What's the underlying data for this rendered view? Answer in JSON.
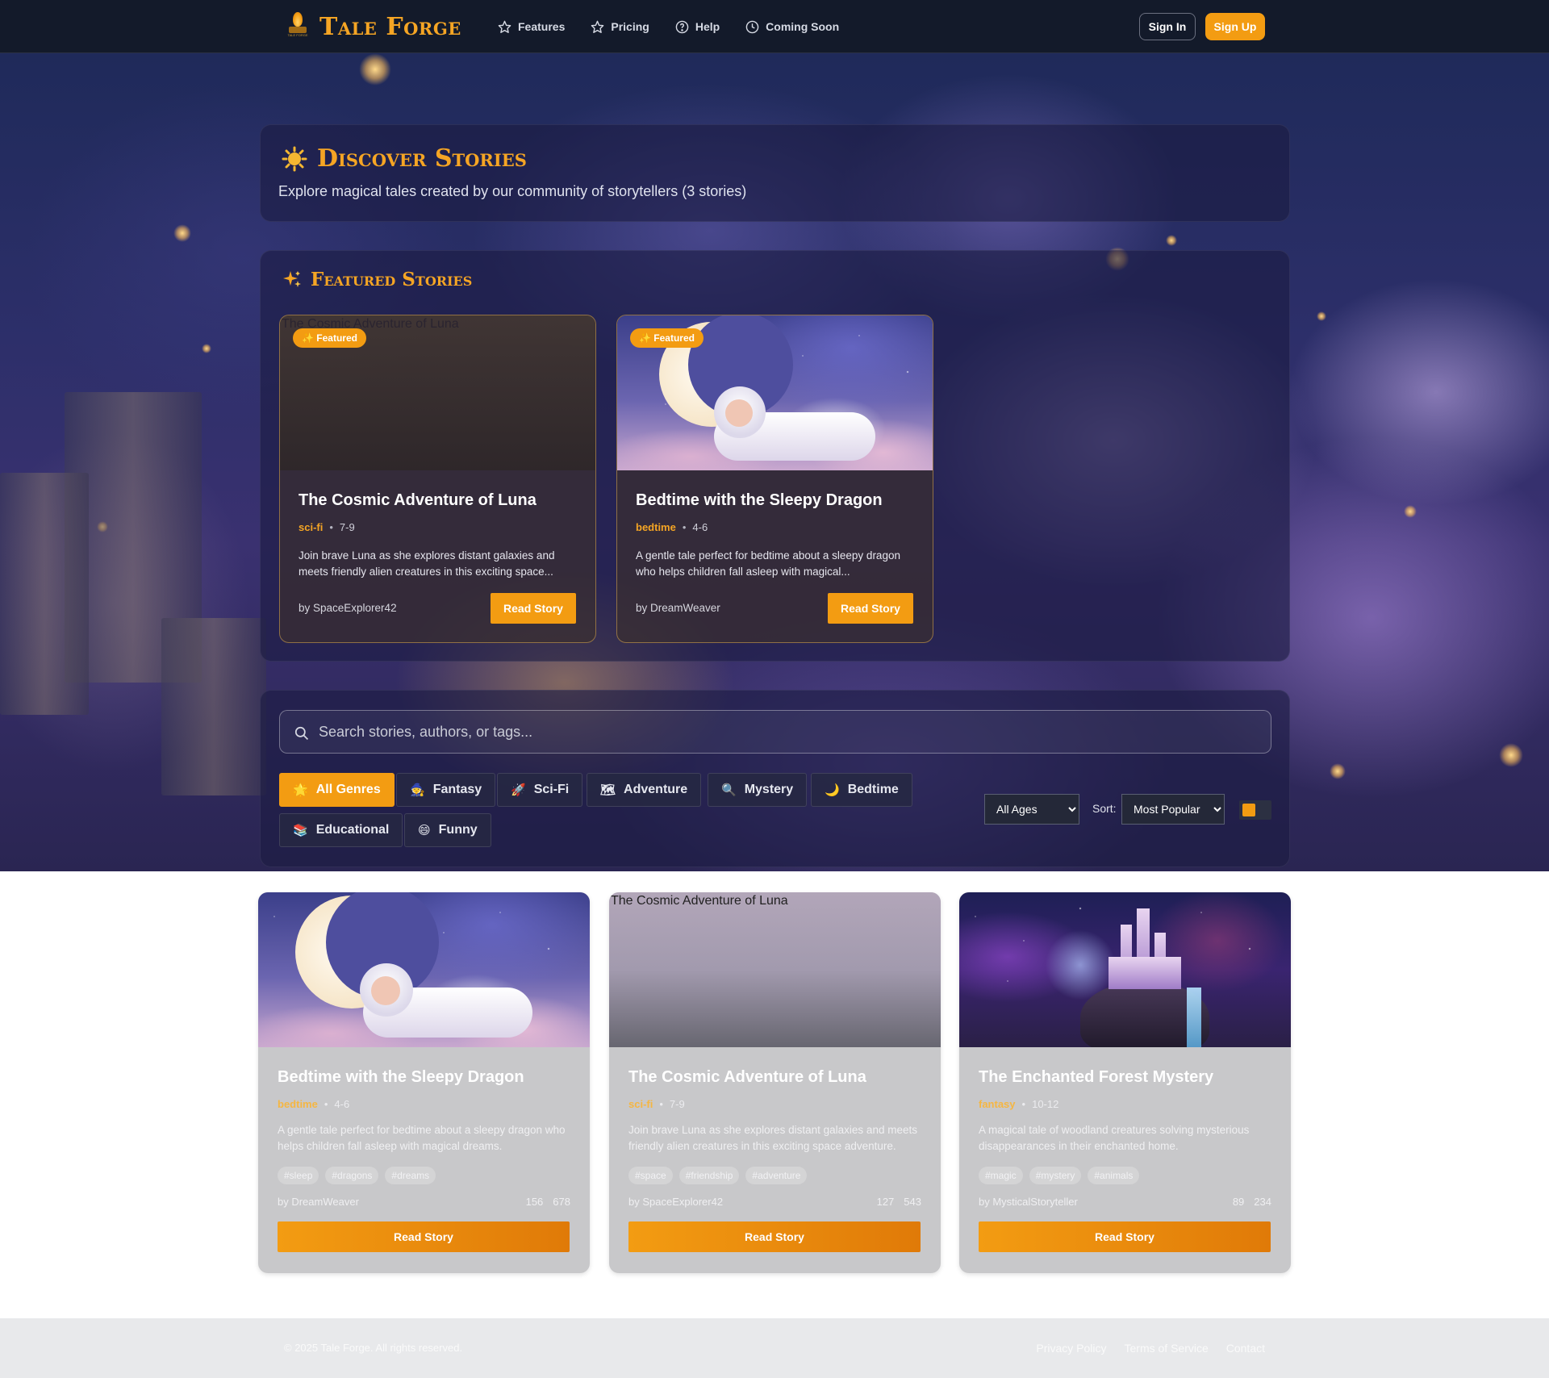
{
  "nav": {
    "logo_text": "Tale Forge",
    "logo_small_text": "TALE FORGE",
    "links": [
      {
        "label": "Features",
        "icon": "star-icon"
      },
      {
        "label": "Pricing",
        "icon": "star-icon"
      },
      {
        "label": "Help",
        "icon": "help-circle-icon"
      },
      {
        "label": "Coming Soon",
        "icon": "clock-icon"
      }
    ],
    "sign_in": "Sign In",
    "sign_up": "Sign Up"
  },
  "discover": {
    "icon": "sun-icon",
    "title": "Discover Stories",
    "subtitle": "Explore magical tales created by our community of storytellers (3 stories)"
  },
  "featured": {
    "icon": "sparkles-icon",
    "title": "Featured Stories",
    "cards": [
      {
        "image_alt": "The Cosmic Adventure of Luna",
        "badge": "✨ Featured",
        "title": "The Cosmic Adventure of Luna",
        "genre": "sci-fi",
        "age": "7-9",
        "description": "Join brave Luna as she explores distant galaxies and meets friendly alien creatures in this exciting space...",
        "author": "by SpaceExplorer42",
        "button": "Read Story"
      },
      {
        "image_alt": "Bedtime with the Sleepy Dragon",
        "badge": "✨ Featured",
        "title": "Bedtime with the Sleepy Dragon",
        "genre": "bedtime",
        "age": "4-6",
        "description": "A gentle tale perfect for bedtime about a sleepy dragon who helps children fall asleep with magical...",
        "author": "by DreamWeaver",
        "button": "Read Story"
      }
    ]
  },
  "filters": {
    "search_placeholder": "Search stories, authors, or tags...",
    "genres": [
      {
        "emoji": "🌟",
        "label": "All Genres",
        "active": true
      },
      {
        "emoji": "🧙",
        "label": "Fantasy",
        "active": false
      },
      {
        "emoji": "🚀",
        "label": "Sci-Fi",
        "active": false
      },
      {
        "emoji": "🗺",
        "label": "Adventure",
        "active": false
      },
      {
        "emoji": "🔍",
        "label": "Mystery",
        "active": false
      },
      {
        "emoji": "🌙",
        "label": "Bedtime",
        "active": false
      },
      {
        "emoji": "📚",
        "label": "Educational",
        "active": false
      },
      {
        "emoji": "😄",
        "label": "Funny",
        "active": false
      }
    ],
    "age_selected": "All Ages",
    "sort_label": "Sort:",
    "sort_selected": "Most Popular"
  },
  "stories": [
    {
      "image_alt": "Bedtime with the Sleepy Dragon",
      "title": "Bedtime with the Sleepy Dragon",
      "genre": "bedtime",
      "age": "4-6",
      "description": "A gentle tale perfect for bedtime about a sleepy dragon who helps children fall asleep with magical dreams.",
      "tags": [
        "#sleep",
        "#dragons",
        "#dreams"
      ],
      "author": "by DreamWeaver",
      "stat_a": "156",
      "stat_b": "678",
      "button": "Read Story"
    },
    {
      "image_alt": "The Cosmic Adventure of Luna",
      "title": "The Cosmic Adventure of Luna",
      "genre": "sci-fi",
      "age": "7-9",
      "description": "Join brave Luna as she explores distant galaxies and meets friendly alien creatures in this exciting space adventure.",
      "tags": [
        "#space",
        "#friendship",
        "#adventure"
      ],
      "author": "by SpaceExplorer42",
      "stat_a": "127",
      "stat_b": "543",
      "button": "Read Story"
    },
    {
      "image_alt": "The Enchanted Forest Mystery",
      "title": "The Enchanted Forest Mystery",
      "genre": "fantasy",
      "age": "10-12",
      "description": "A magical tale of woodland creatures solving mysterious disappearances in their enchanted home.",
      "tags": [
        "#magic",
        "#mystery",
        "#animals"
      ],
      "author": "by MysticalStoryteller",
      "stat_a": "89",
      "stat_b": "234",
      "button": "Read Story"
    }
  ],
  "footer": {
    "copyright": "© 2025 Tale Forge. All rights reserved.",
    "links": [
      "Privacy Policy",
      "Terms of Service",
      "Contact"
    ]
  },
  "colors": {
    "accent": "#f39c12",
    "nav_bg": "#131a2a",
    "panel_bg": "#1c1c42",
    "card_bg": "#c8c8ca",
    "footer_bg": "#e8e9eb"
  }
}
